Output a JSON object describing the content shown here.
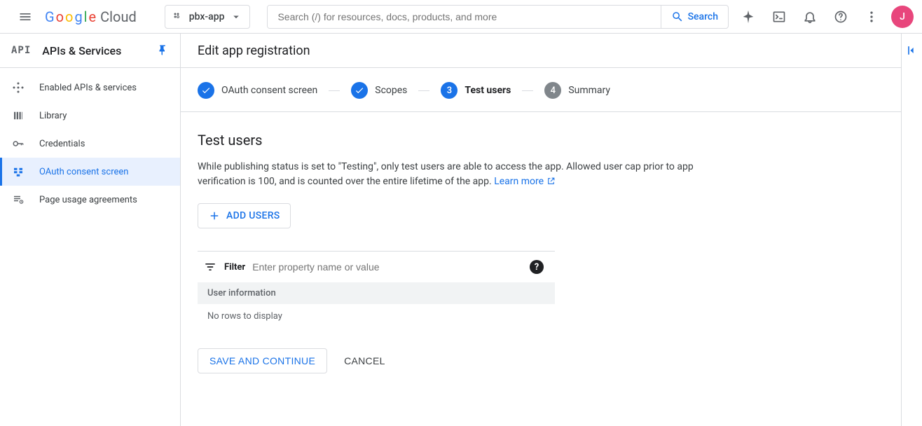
{
  "header": {
    "project_name": "pbx-app",
    "search_placeholder": "Search (/) for resources, docs, products, and more",
    "search_button": "Search",
    "avatar_initial": "J"
  },
  "sidebar": {
    "service_logo": "API",
    "service_title": "APIs & Services",
    "items": [
      {
        "label": "Enabled APIs & services"
      },
      {
        "label": "Library"
      },
      {
        "label": "Credentials"
      },
      {
        "label": "OAuth consent screen"
      },
      {
        "label": "Page usage agreements"
      }
    ]
  },
  "page": {
    "title": "Edit app registration",
    "steps": [
      {
        "label": "OAuth consent screen"
      },
      {
        "label": "Scopes"
      },
      {
        "label": "Test users",
        "num": "3"
      },
      {
        "label": "Summary",
        "num": "4"
      }
    ]
  },
  "section": {
    "heading": "Test users",
    "description": "While publishing status is set to \"Testing\", only test users are able to access the app. Allowed user cap prior to app verification is 100, and is counted over the entire lifetime of the app. ",
    "learn_more": "Learn more",
    "add_users": "ADD USERS",
    "filter_label": "Filter",
    "filter_placeholder": "Enter property name or value",
    "table_header": "User information",
    "empty_text": "No rows to display"
  },
  "actions": {
    "save": "SAVE AND CONTINUE",
    "cancel": "CANCEL"
  }
}
